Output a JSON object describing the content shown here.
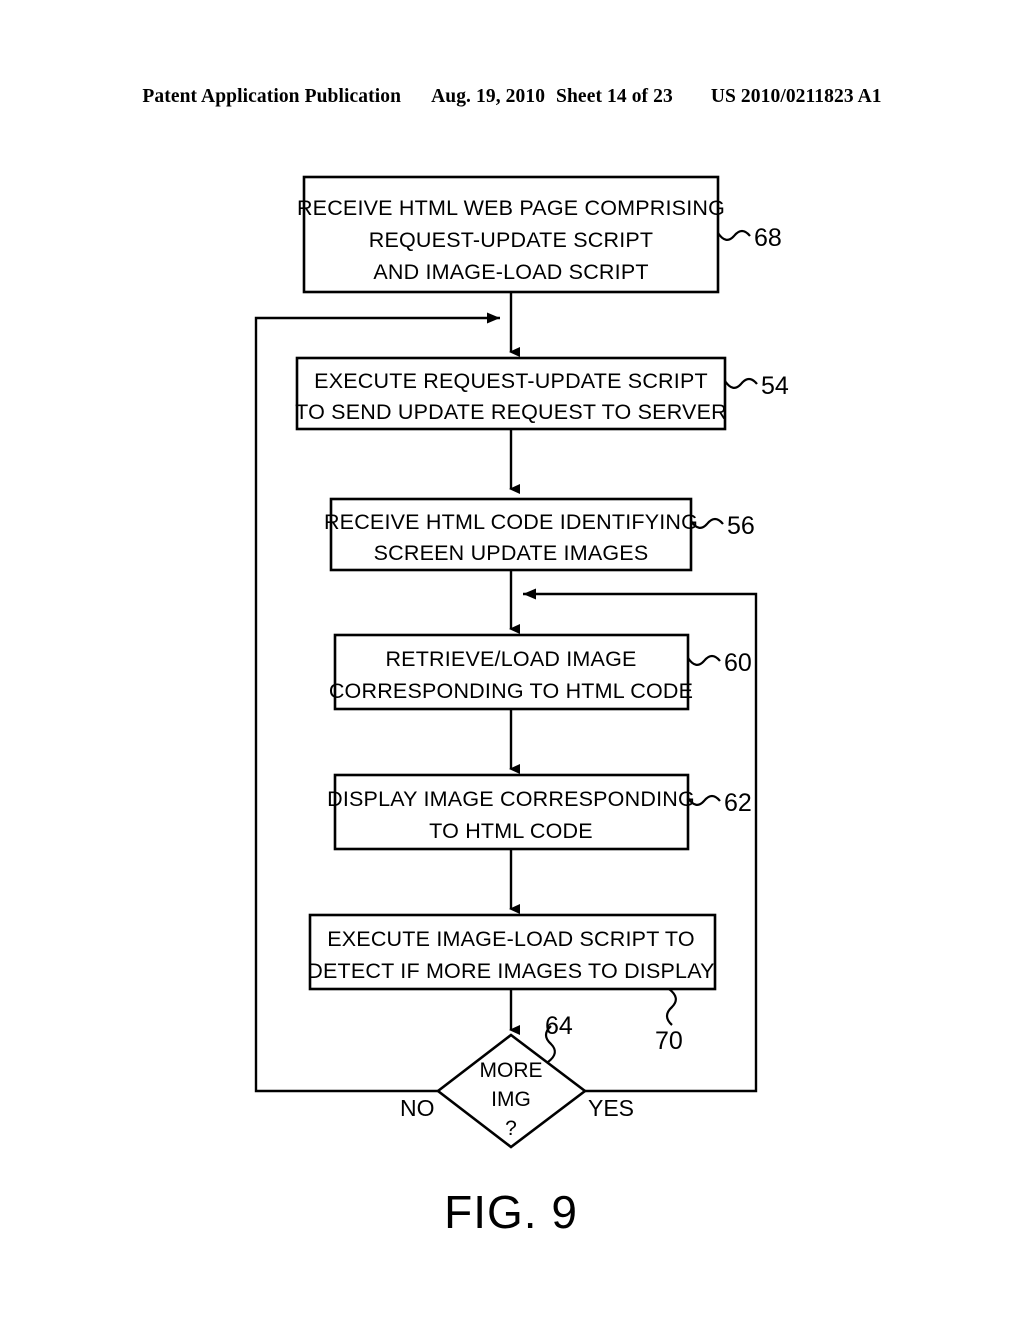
{
  "header": {
    "publication": "Patent Application Publication",
    "date": "Aug. 19, 2010",
    "sheet": "Sheet 14 of 23",
    "patent_number": "US 2010/0211823 A1"
  },
  "figure": {
    "label": "FIG. 9"
  },
  "chart_data": {
    "type": "diagram",
    "diagram_kind": "flowchart",
    "title": "FIG. 9",
    "nodes": [
      {
        "id": "68",
        "ref": "68",
        "shape": "process",
        "lines": [
          "RECEIVE HTML WEB PAGE COMPRISING",
          "REQUEST-UPDATE SCRIPT",
          "AND IMAGE-LOAD SCRIPT"
        ]
      },
      {
        "id": "54",
        "ref": "54",
        "shape": "process",
        "lines": [
          "EXECUTE REQUEST-UPDATE SCRIPT",
          "TO SEND UPDATE REQUEST TO SERVER"
        ]
      },
      {
        "id": "56",
        "ref": "56",
        "shape": "process",
        "lines": [
          "RECEIVE HTML CODE IDENTIFYING",
          "SCREEN UPDATE IMAGES"
        ]
      },
      {
        "id": "60",
        "ref": "60",
        "shape": "process",
        "lines": [
          "RETRIEVE/LOAD IMAGE",
          "CORRESPONDING TO HTML CODE"
        ]
      },
      {
        "id": "62",
        "ref": "62",
        "shape": "process",
        "lines": [
          "DISPLAY IMAGE CORRESPONDING",
          "TO HTML CODE"
        ]
      },
      {
        "id": "70node",
        "ref": "70",
        "shape": "process",
        "lines": [
          "EXECUTE IMAGE-LOAD SCRIPT TO",
          "DETECT IF MORE IMAGES TO DISPLAY"
        ]
      },
      {
        "id": "64",
        "ref": "64",
        "shape": "decision",
        "lines": [
          "MORE",
          "IMG",
          "?"
        ]
      }
    ],
    "edges": [
      {
        "from": "68",
        "to": "54",
        "label": ""
      },
      {
        "from": "54",
        "to": "56",
        "label": ""
      },
      {
        "from": "56",
        "to": "60",
        "label": ""
      },
      {
        "from": "60",
        "to": "62",
        "label": ""
      },
      {
        "from": "62",
        "to": "70node",
        "label": ""
      },
      {
        "from": "70node",
        "to": "64",
        "label": ""
      },
      {
        "from": "64",
        "to": "54",
        "label": "NO"
      },
      {
        "from": "64",
        "to": "60",
        "label": "YES"
      }
    ],
    "branch_labels": {
      "no": "NO",
      "yes": "YES"
    },
    "reference_numerals": [
      "68",
      "54",
      "56",
      "60",
      "62",
      "64",
      "70"
    ]
  }
}
